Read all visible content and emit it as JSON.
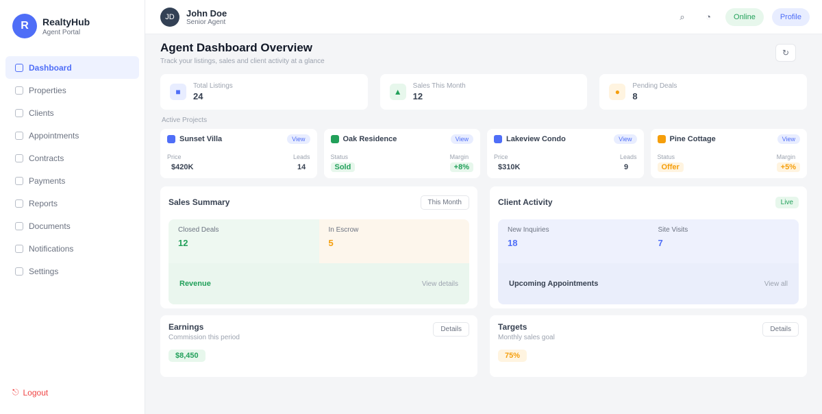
{
  "brand": {
    "logo_letter": "R",
    "name": "RealtyHub",
    "subtitle": "Agent Portal"
  },
  "nav": [
    {
      "label": "Dashboard",
      "active": true
    },
    {
      "label": "Properties"
    },
    {
      "label": "Clients"
    },
    {
      "label": "Appointments"
    },
    {
      "label": "Contracts"
    },
    {
      "label": "Payments"
    },
    {
      "label": "Reports"
    },
    {
      "label": "Documents"
    },
    {
      "label": "Notifications"
    },
    {
      "label": "Settings"
    }
  ],
  "logout_label": "Logout",
  "topbar": {
    "avatar_initials": "JD",
    "title": "John Doe",
    "subtitle": "Senior Agent",
    "status_pill": "Online",
    "action_pill": "Profile"
  },
  "page": {
    "title": "Agent Dashboard Overview",
    "subtitle": "Track your listings, sales and client activity at a glance"
  },
  "stats": [
    {
      "label": "Total Listings",
      "value": "24",
      "color": "#4f6ef7",
      "bg": "#e8edff"
    },
    {
      "label": "Sales This Month",
      "value": "12",
      "color": "#22a05a",
      "bg": "#e7f7ec"
    },
    {
      "label": "Pending Deals",
      "value": "8",
      "color": "#f59e0b",
      "bg": "#fff4e0"
    }
  ],
  "projects_label": "Active Projects",
  "projects": [
    {
      "name": "Sunset Villa",
      "tag": "View",
      "dot": "#4f6ef7",
      "m1_label": "Price",
      "m1_value": "$420K",
      "m1_color": "#374151",
      "m1_bg": "transparent",
      "m2_label": "Leads",
      "m2_value": "14",
      "m2_color": "#374151",
      "m2_bg": "transparent"
    },
    {
      "name": "Oak Residence",
      "tag": "View",
      "dot": "#22a05a",
      "m1_label": "Status",
      "m1_value": "Sold",
      "m1_color": "#22a05a",
      "m1_bg": "#e7f7ec",
      "m2_label": "Margin",
      "m2_value": "+8%",
      "m2_color": "#22a05a",
      "m2_bg": "#e7f7ec"
    },
    {
      "name": "Lakeview Condo",
      "tag": "View",
      "dot": "#4f6ef7",
      "m1_label": "Price",
      "m1_value": "$310K",
      "m1_color": "#374151",
      "m1_bg": "transparent",
      "m2_label": "Leads",
      "m2_value": "9",
      "m2_color": "#374151",
      "m2_bg": "transparent"
    },
    {
      "name": "Pine Cottage",
      "tag": "View",
      "dot": "#f59e0b",
      "m1_label": "Status",
      "m1_value": "Offer",
      "m1_color": "#f59e0b",
      "m1_bg": "#fff4e0",
      "m2_label": "Margin",
      "m2_value": "+5%",
      "m2_color": "#f59e0b",
      "m2_bg": "#fff4e0"
    }
  ],
  "panel_left": {
    "title": "Sales Summary",
    "button": "This Month",
    "tiles": [
      {
        "label": "Closed Deals",
        "value": "12",
        "color": "#22a05a",
        "bg": "#eef8f1"
      },
      {
        "label": "In Escrow",
        "value": "5",
        "color": "#f59e0b",
        "bg": "#fdf6ec"
      }
    ],
    "wide": {
      "label": "Revenue",
      "right": "View details",
      "color": "#22a05a",
      "bg": "#eaf6ee"
    }
  },
  "panel_right": {
    "title": "Client Activity",
    "badge": "Live",
    "tiles": [
      {
        "label": "New Inquiries",
        "value": "18",
        "color": "#4f6ef7",
        "bg": "#eef1fd"
      },
      {
        "label": "Site Visits",
        "value": "7",
        "color": "#4f6ef7",
        "bg": "#eef1fd"
      }
    ],
    "wide": {
      "label": "Upcoming Appointments",
      "right": "View all",
      "color": "#374151",
      "bg": "#eaeefb"
    }
  },
  "bottom": [
    {
      "title": "Earnings",
      "subtitle": "Commission this period",
      "button": "Details",
      "value": "$8,450",
      "color": "#22a05a",
      "bg": "#e7f7ec"
    },
    {
      "title": "Targets",
      "subtitle": "Monthly sales goal",
      "button": "Details",
      "value": "75%",
      "color": "#f59e0b",
      "bg": "#fff4e0"
    }
  ]
}
